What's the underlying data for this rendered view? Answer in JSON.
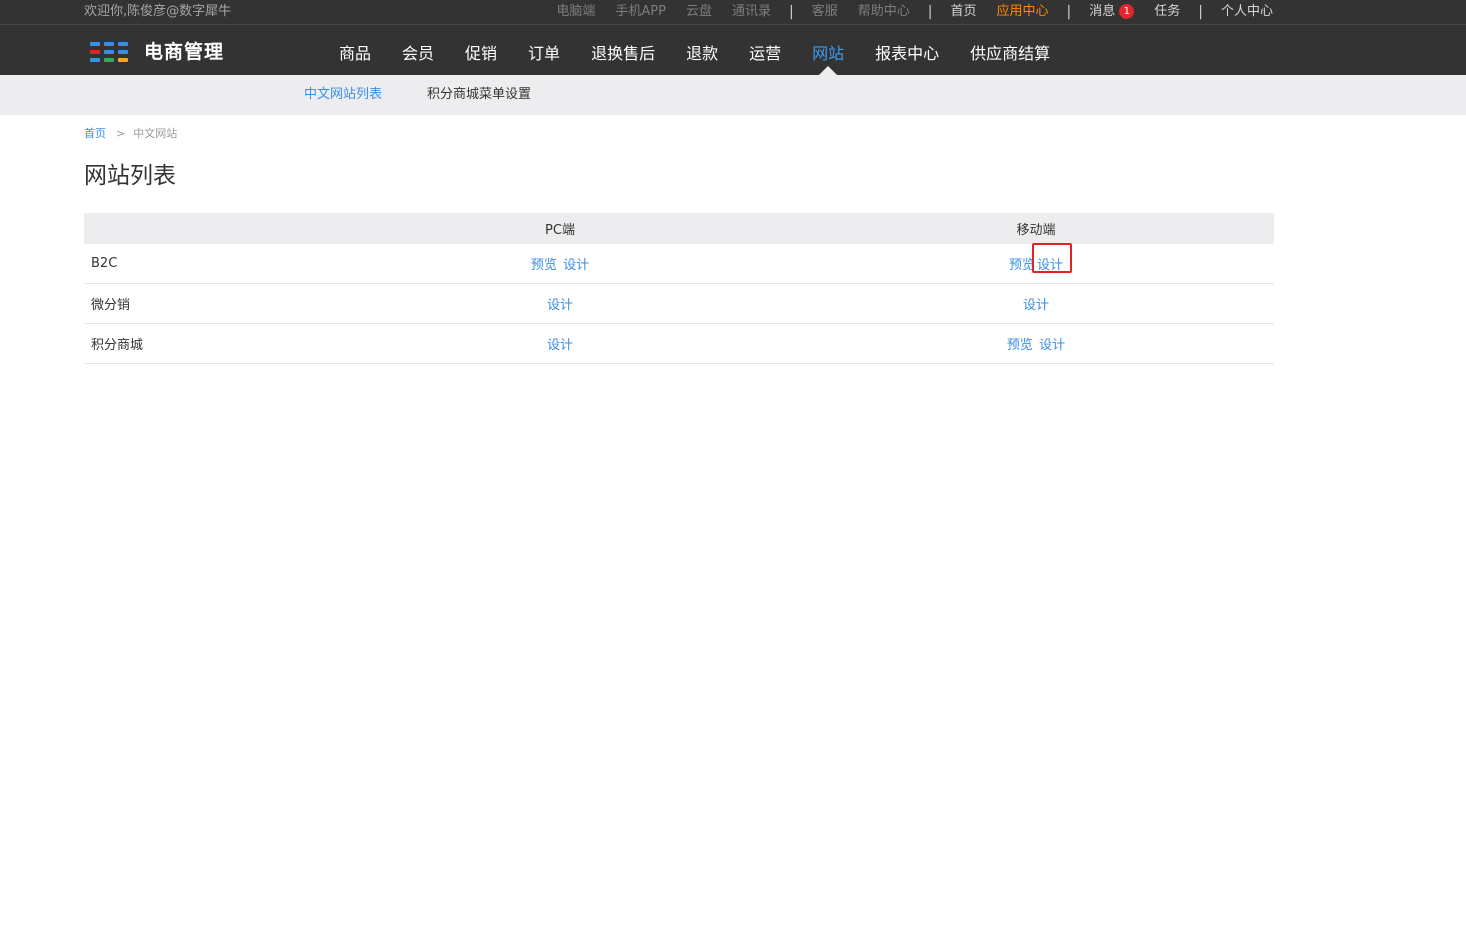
{
  "header": {
    "welcome": "欢迎你,陈俊彦@数字犀牛",
    "links": [
      {
        "label": "电脑端",
        "style": "dim"
      },
      {
        "label": "手机APP",
        "style": "dim"
      },
      {
        "label": "云盘",
        "style": "dim"
      },
      {
        "label": "通讯录",
        "style": "dim"
      },
      {
        "label": "客服",
        "style": "dim"
      },
      {
        "label": "帮助中心",
        "style": "dim"
      },
      {
        "label": "首页",
        "style": "lit"
      },
      {
        "label": "应用中心",
        "style": "app"
      },
      {
        "label": "消息",
        "style": "lit"
      },
      {
        "label": "任务",
        "style": "lit"
      },
      {
        "label": "个人中心",
        "style": "lit"
      }
    ],
    "separator": "|",
    "message_count": "1"
  },
  "logo": {
    "text": "电商管理",
    "icon": "grid-logo-icon",
    "colors": [
      "#3a8ee6",
      "#e02424",
      "#2fae5a",
      "#f5a623"
    ]
  },
  "main_nav": {
    "items": [
      "商品",
      "会员",
      "促销",
      "订单",
      "退换售后",
      "退款",
      "运营",
      "网站",
      "报表中心",
      "供应商结算"
    ],
    "active_index": 7
  },
  "sub_nav": {
    "items": [
      "中文网站列表",
      "积分商城菜单设置"
    ],
    "active_index": 0
  },
  "breadcrumb": {
    "home": "首页",
    "separator": ">",
    "current": "中文网站"
  },
  "page_title": "网站列表",
  "site_table": {
    "headers": [
      "",
      "PC端",
      "移动端"
    ],
    "rows": [
      {
        "name": "B2C",
        "pc": [
          "预览",
          "设计"
        ],
        "mobile": [
          "预览",
          "设计"
        ]
      },
      {
        "name": "微分销",
        "pc": [
          "设计"
        ],
        "mobile": [
          "设计"
        ]
      },
      {
        "name": "积分商城",
        "pc": [
          "设计"
        ],
        "mobile": [
          "预览",
          "设计"
        ]
      }
    ]
  },
  "colors": {
    "header_bg": "#333333",
    "accent": "#3a8ee6",
    "app_center": "#ff8a00",
    "badge": "#e3262b",
    "highlight_box": "#e02424",
    "subnav_bg": "#ededf0"
  }
}
